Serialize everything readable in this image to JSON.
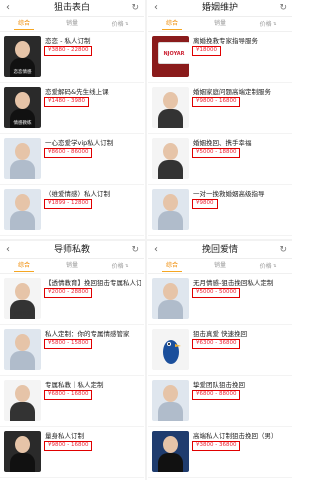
{
  "colors": {
    "accent": "#f08a00",
    "price": "#e22222",
    "highlight_border": "#e00000"
  },
  "panels": [
    {
      "title": "狙击表白",
      "tabs": [
        "综合",
        "销量",
        "价格"
      ],
      "items": [
        {
          "name": "恋恋 - 私人订制",
          "price": "¥3880 - 22800",
          "thumb_caption": "恋恋情感"
        },
        {
          "name": "恋爱解码&先生线上课",
          "price": "¥1480 - 3980",
          "thumb_caption": "情感教练"
        },
        {
          "name": "一心恋爱学vip私人订制",
          "price": "¥8600 - 86000",
          "thumb_caption": ""
        },
        {
          "name": "（维爱情感）私人订制",
          "price": "¥1899 - 12800",
          "thumb_caption": ""
        }
      ]
    },
    {
      "title": "婚姻维护",
      "tabs": [
        "综合",
        "销量",
        "价格"
      ],
      "items": [
        {
          "name": "离婚挽救专家指导服务",
          "price": "¥18000",
          "thumb_caption": "NJOYAR"
        },
        {
          "name": "婚姻家庭问题高端定制服务",
          "price": "¥9800 - 16800",
          "thumb_caption": ""
        },
        {
          "name": "婚姻挽回、携手幸福",
          "price": "¥5000 - 18800",
          "thumb_caption": ""
        },
        {
          "name": "一对一挽救婚姻高级指导",
          "price": "¥9800",
          "thumb_caption": ""
        }
      ]
    },
    {
      "title": "导师私教",
      "tabs": [
        "综合",
        "销量",
        "价格"
      ],
      "items": [
        {
          "name": "【透情教育】挽回狙击专属私人订制",
          "price": "¥2000 - 28800",
          "thumb_caption": "透情教育"
        },
        {
          "name": "私人定制：你的专属情感管家",
          "price": "¥5800 - 15800",
          "thumb_caption": ""
        },
        {
          "name": "专属私教｜私人定制",
          "price": "¥6800 - 16800",
          "thumb_caption": ""
        },
        {
          "name": "量身私人订制",
          "price": "¥9800 - 16800",
          "thumb_caption": ""
        }
      ]
    },
    {
      "title": "挽回爱情",
      "tabs": [
        "综合",
        "销量",
        "价格"
      ],
      "items": [
        {
          "name": "无月情感-狙击挽回私人定制",
          "price": "¥5000 - 50000",
          "thumb_caption": ""
        },
        {
          "name": "狙击真爱 快速挽回",
          "price": "¥6300 - 36800",
          "thumb_caption": ""
        },
        {
          "name": "挚爱团队狙击挽回",
          "price": "¥6800 - 88000",
          "thumb_caption": ""
        },
        {
          "name": "高端私人订制狙击挽回（男）",
          "price": "¥3800 - 36800",
          "thumb_caption": ""
        }
      ]
    }
  ]
}
